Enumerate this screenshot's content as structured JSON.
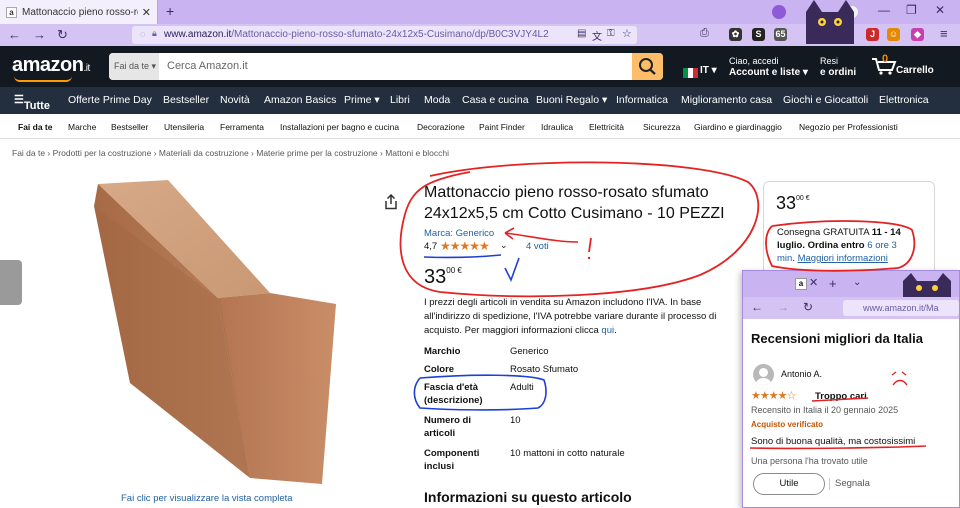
{
  "browser": {
    "tab_title": "Mattonaccio pieno rosso-rosato",
    "tab_favicon": "a",
    "url_domain": "www.amazon.it",
    "url_path": "/Mattonaccio-pieno-rosso-sfumato-24x12x5-Cusimano/dp/B0C3VJY4L2",
    "ext_badge_1": "65",
    "ext_badge_2": "2"
  },
  "header": {
    "logo": "amazon",
    "logo_tld": ".it",
    "search_dept": "Fai da te ▾",
    "search_placeholder": "Cerca Amazon.it",
    "lang": "IT ▾",
    "account_l1": "Ciao, accedi",
    "account_l2": "Account e liste ▾",
    "returns_l1": "Resi",
    "returns_l2": "e ordini",
    "cart_count": "0",
    "cart_label": "Carrello"
  },
  "mainnav": {
    "all": "Tutte",
    "items": [
      "Offerte Prime Day",
      "Bestseller",
      "Novità",
      "Amazon Basics",
      "Prime ▾",
      "Libri",
      "Moda",
      "Casa e cucina",
      "Buoni Regalo ▾",
      "Informatica",
      "Miglioramento casa",
      "Giochi e Giocattoli",
      "Elettronica"
    ]
  },
  "subnav": {
    "items": [
      "Fai da te",
      "Marche",
      "Bestseller",
      "Utensileria",
      "Ferramenta",
      "Installazioni per bagno e cucina",
      "Decorazione",
      "Paint Finder",
      "Idraulica",
      "Elettricità",
      "Sicurezza",
      "Giardino e giardinaggio",
      "Negozio per Professionisti"
    ]
  },
  "breadcrumb": "Fai da te › Prodotti per la costruzione › Materiali da costruzione › Materie prime per la costruzione › Mattoni e blocchi",
  "product": {
    "title": "Mattonaccio pieno rosso-rosato sfumato 24x12x5,5 cm Cotto Cusimano - 10 PEZZI",
    "brand": "Marca: Generico",
    "rating": "4,7",
    "stars": "★★★★★",
    "votes": "4 voti",
    "price_int": "33",
    "price_dec": "00 €",
    "vat_note": "I prezzi degli articoli in vendita su Amazon includono l'IVA. In base all'indirizzo di spedizione, l'IVA potrebbe variare durante il processo di acquisto. Per maggiori informazioni clicca ",
    "vat_link": "qui",
    "image_caption": "Fai clic per visualizzare la vista completa",
    "specs": [
      {
        "k": "Marchio",
        "v": "Generico"
      },
      {
        "k": "Colore",
        "v": "Rosato Sfumato"
      },
      {
        "k": "Fascia d'età (descrizione)",
        "v": "Adulti"
      },
      {
        "k": "Numero di articoli",
        "v": "10"
      },
      {
        "k": "Componenti inclusi",
        "v": "10 mattoni in cotto naturale"
      }
    ],
    "info_heading": "Informazioni su questo articolo"
  },
  "buybox": {
    "price_int": "33",
    "price_dec": "00 €",
    "delivery_pre": "Consegna GRATUITA ",
    "delivery_date": "11 - 14 luglio",
    "order_pre": ". Ordina entro ",
    "order_time": "6 ore 3 min",
    "more_info": "Maggiori informazioni"
  },
  "popup": {
    "url": "www.amazon.it/Ma",
    "heading": "Recensioni migliori da Italia",
    "reviewer": "Antonio A.",
    "stars": "★★★★☆",
    "review_title": "Troppo cari",
    "date": "Recensito in Italia il 20 gennaio 2025",
    "verified": "Acquisto verificato",
    "body": "Sono di buona qualità, ma costosissimi",
    "helpful": "Una persona l'ha trovato utile",
    "useful_btn": "Utile",
    "report": "Segnala"
  },
  "colors": {
    "chrome_tab": "#c9b3f0",
    "amazon_dark": "#131921",
    "amazon_nav": "#232f3e",
    "link": "#2162a1",
    "star": "#de7921",
    "annotation_red": "#e52222",
    "annotation_blue": "#1d3fd6"
  }
}
